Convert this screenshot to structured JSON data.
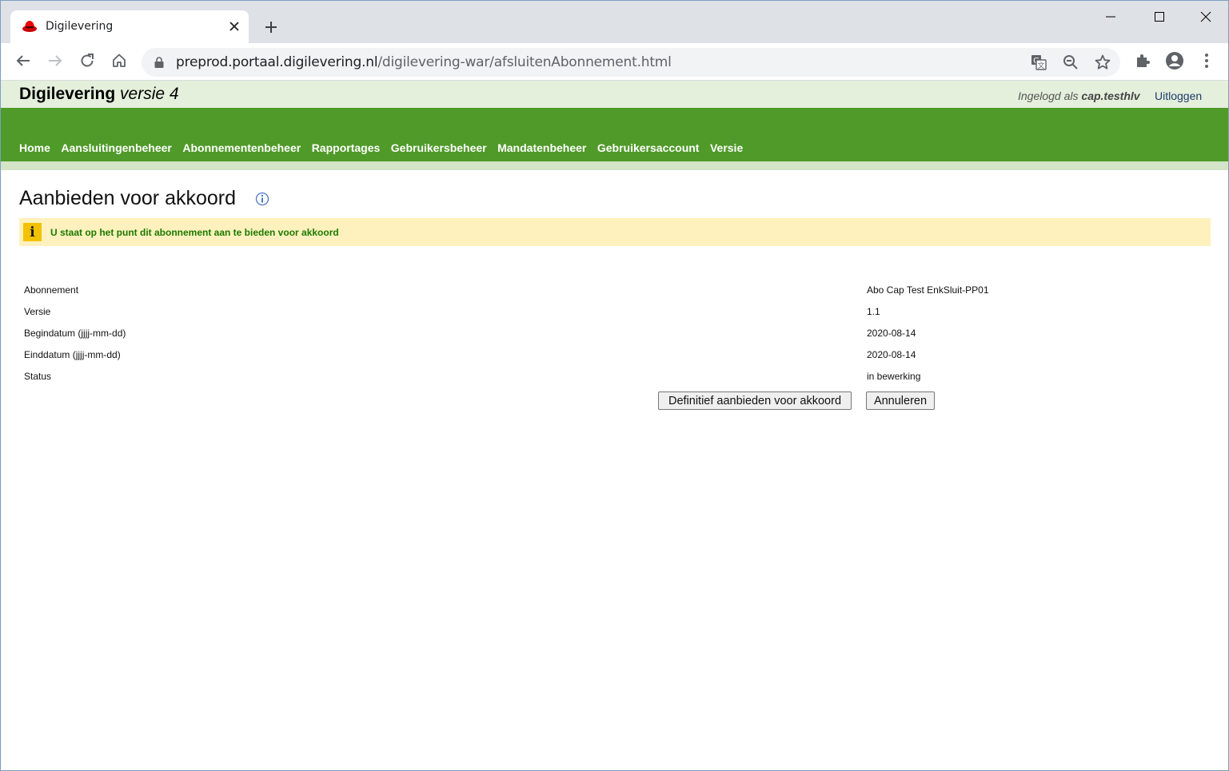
{
  "browser": {
    "tab_title": "Digilevering",
    "url_host": "preprod.portaal.digilevering.nl",
    "url_path": "/digilevering-war/afsluitenAbonnement.html"
  },
  "header": {
    "brand": "Digilevering",
    "brand_version": "versie 4",
    "logged_in_prefix": "Ingelogd als",
    "username": "cap.testhlv",
    "logout": "Uitloggen"
  },
  "nav": {
    "items": [
      "Home",
      "Aansluitingenbeheer",
      "Abonnementenbeheer",
      "Rapportages",
      "Gebruikersbeheer",
      "Mandatenbeheer",
      "Gebruikersaccount",
      "Versie"
    ]
  },
  "page": {
    "title": "Aanbieden voor akkoord",
    "alert": "U staat op het punt dit abonnement aan te bieden voor akkoord",
    "details": [
      {
        "label": "Abonnement",
        "value": "Abo Cap Test EnkSluit-PP01"
      },
      {
        "label": "Versie",
        "value": "1.1"
      },
      {
        "label": "Begindatum (jjjj-mm-dd)",
        "value": "2020-08-14"
      },
      {
        "label": "Einddatum (jjjj-mm-dd)",
        "value": "2020-08-14"
      },
      {
        "label": "Status",
        "value": "in bewerking"
      }
    ],
    "submit_button": "Definitief aanbieden voor akkoord",
    "cancel_button": "Annuleren"
  },
  "colors": {
    "nav_green": "#4f9a28",
    "header_bg": "#e4efdc",
    "alert_bg": "#fff1bd",
    "alert_text": "#1a7a00"
  }
}
